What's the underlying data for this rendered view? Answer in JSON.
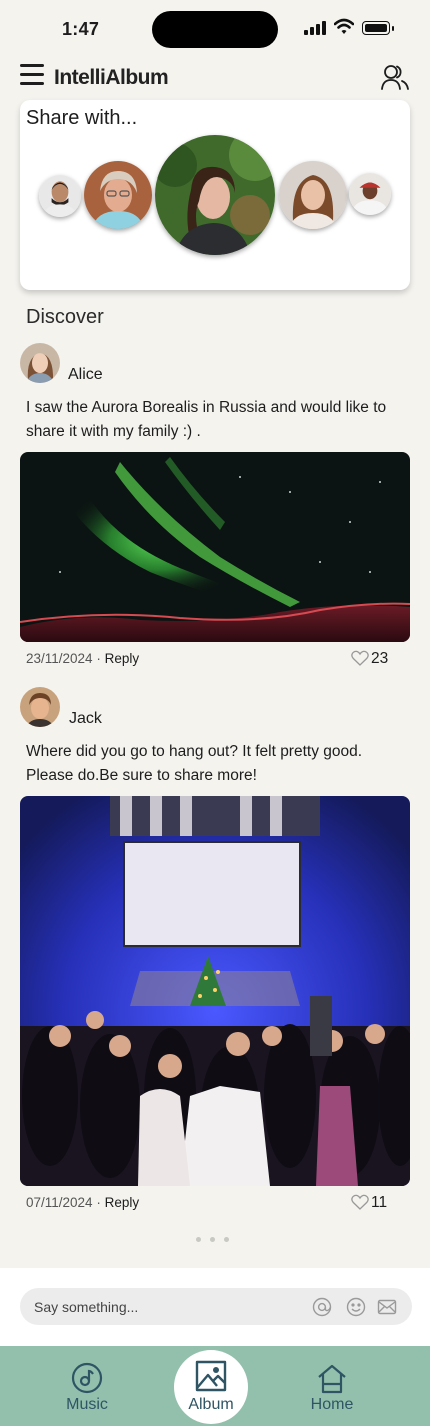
{
  "status_bar": {
    "time": "1:47"
  },
  "app": {
    "title": "IntelliAlbum"
  },
  "share": {
    "title": "Share with..."
  },
  "discover": {
    "title": "Discover",
    "posts": [
      {
        "user": "Alice",
        "text": "I saw the Aurora Borealis in Russia and would like to share it with my family :) .",
        "date": "23/11/2024",
        "reply_label": "Reply",
        "likes": "23"
      },
      {
        "user": "Jack",
        "text": "Where did you go to hang out? It felt pretty good. Please do.Be sure to share more!",
        "date": "07/11/2024",
        "reply_label": "Reply",
        "likes": "11"
      }
    ]
  },
  "composer": {
    "placeholder": "Say something..."
  },
  "nav": {
    "tabs": [
      {
        "label": "Music"
      },
      {
        "label": "Album"
      },
      {
        "label": "Home"
      }
    ],
    "active": "Album"
  },
  "colors": {
    "background": "#f4f3ee",
    "nav": "#93c0ac",
    "nav_icon": "#2f5565"
  },
  "icons": [
    "menu-icon",
    "people-icon",
    "heart-icon",
    "at-icon",
    "smiley-icon",
    "mail-icon",
    "music-icon",
    "album-icon",
    "home-icon"
  ]
}
